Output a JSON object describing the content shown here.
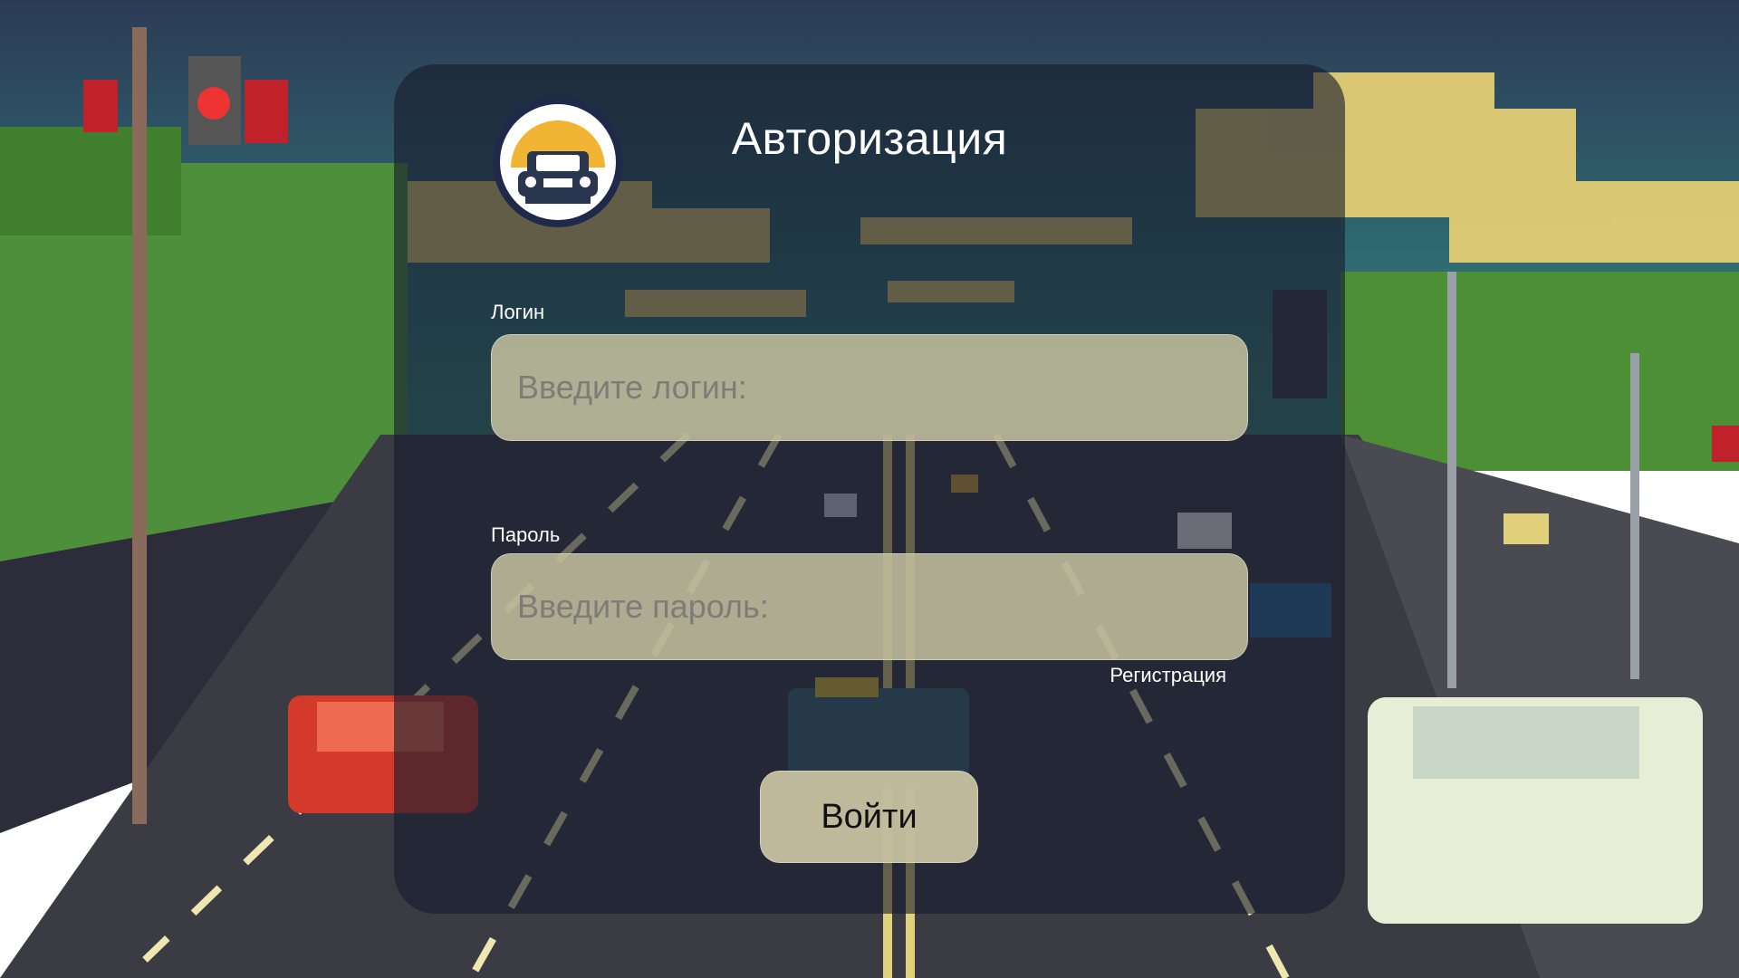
{
  "background": {
    "image": "pixel-art-highway-scene",
    "colors": {
      "sky": "#2f5b6b",
      "road": "#3a3a40",
      "grass": "#5a9a3a",
      "cloud": "#e8d27a"
    }
  },
  "form": {
    "logo": "car-logo-icon",
    "title": "Авторизация",
    "login": {
      "label": "Логин",
      "placeholder": "Введите логин:",
      "value": ""
    },
    "password": {
      "label": "Пароль",
      "placeholder": "Введите пароль:",
      "value": ""
    },
    "register_link": "Регистрация",
    "submit_label": "Войти",
    "colors": {
      "panel": "#161c2c",
      "input": "#c6c1a0",
      "text": "#ffffff"
    }
  }
}
